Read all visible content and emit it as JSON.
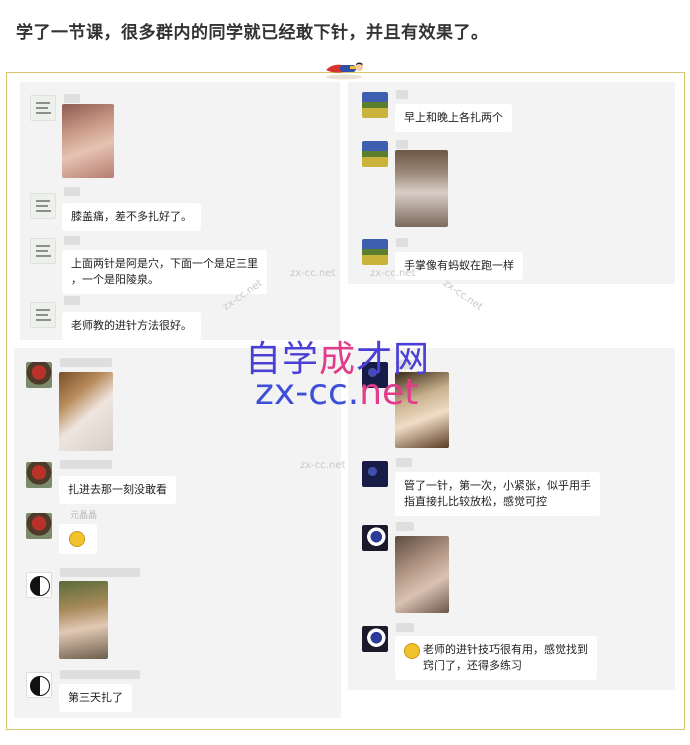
{
  "headline": "学了一节课，很多群内的同学就已经敢下针，并且有效果了。",
  "left_top_chat": {
    "messages": [
      {
        "type": "image"
      },
      {
        "type": "text",
        "text": "膝盖痛，差不多扎好了。"
      },
      {
        "type": "text",
        "line1": "上面两针是阿是穴，下面一个是足三里",
        "line2": "，一个是阳陵泉。"
      },
      {
        "type": "text",
        "text": "老师教的进针方法很好。"
      }
    ]
  },
  "right_top_chat": {
    "messages": [
      {
        "type": "text",
        "text": "早上和晚上各扎两个"
      },
      {
        "type": "image"
      },
      {
        "type": "text",
        "text": "手掌像有蚂蚁在跑一样"
      }
    ]
  },
  "left_bottom_chat": {
    "messages": [
      {
        "type": "image"
      },
      {
        "type": "text",
        "text": "扎进去那一刻没敢看"
      },
      {
        "type": "name",
        "text": "元晶晶"
      },
      {
        "type": "emoji",
        "icon": "crying-laughing-emoji"
      },
      {
        "type": "image"
      },
      {
        "type": "text",
        "text": "第三天扎了"
      }
    ]
  },
  "right_bottom_chat": {
    "messages": [
      {
        "type": "image"
      },
      {
        "type": "text",
        "line1": "管了一针，第一次，小紧张，似乎用手",
        "line2": "指直接扎比较放松，感觉可控"
      },
      {
        "type": "image"
      },
      {
        "type": "text",
        "line1": "老师的进针技巧很有用，感觉找到",
        "line2": "窍门了，还得多练习",
        "icon": "grin-emoji"
      }
    ]
  },
  "watermark": {
    "line1_a": "自学",
    "line1_b": "成",
    "line1_c": "才网",
    "line2_a": "zx-cc.",
    "line2_b": "net"
  },
  "faint_watermarks": [
    "zx-cc.net",
    "zx-cc.net",
    "zx-cc.net",
    "zx-cc.net",
    "zx-cc.net"
  ],
  "colors": {
    "frame": "#d8c46a",
    "panel": "#f3f3f3",
    "watermark_blue": "#4a3fd6",
    "watermark_pink": "#e23c8a"
  }
}
